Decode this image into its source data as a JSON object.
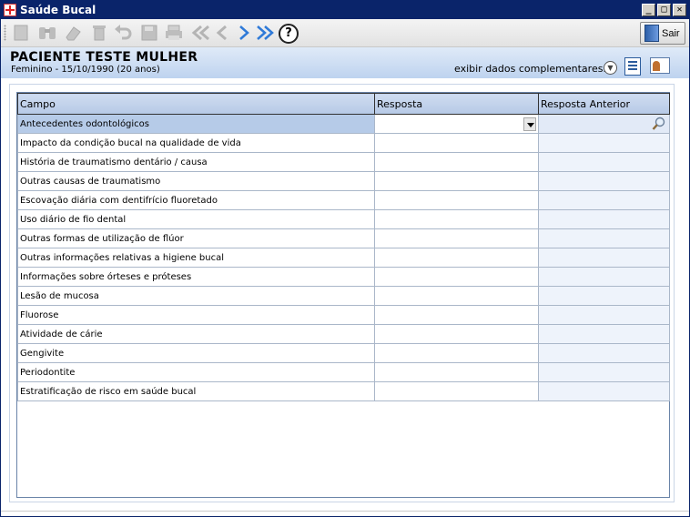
{
  "window": {
    "title": "Saúde Bucal",
    "controls": {
      "minimize": "_",
      "maximize": "□",
      "close": "✕"
    }
  },
  "toolbar": {
    "icons": [
      "new-icon",
      "binoculars-icon",
      "eraser-icon",
      "trash-icon",
      "undo-icon",
      "save-icon",
      "print-icon",
      "first-icon",
      "prev-icon",
      "next-icon",
      "last-icon"
    ],
    "help_label": "?",
    "exit_label": "Sair"
  },
  "patient": {
    "name": "PACIENTE TESTE MULHER",
    "info": "Feminino - 15/10/1990 (20 anos)",
    "extra_link": "exibir dados complementares..."
  },
  "grid": {
    "columns": [
      "Campo",
      "Resposta",
      "Resposta Anterior"
    ],
    "rows": [
      "Antecedentes odontológicos",
      "Impacto da condição bucal na qualidade de vida",
      "História de traumatismo dentário / causa",
      "Outras causas de traumatismo",
      "Escovação diária com dentifrício fluoretado",
      "Uso diário de fio dental",
      "Outras formas de utilização de flúor",
      "Outras informações relativas a higiene bucal",
      "Informações sobre órteses e próteses",
      "Lesão de mucosa",
      "Fluorose",
      "Atividade de cárie",
      "Gengivite",
      "Periodontite",
      "Estratificação de risco em saúde bucal"
    ],
    "selected_row": 0
  },
  "colors": {
    "titlebar": "#0a246a",
    "header_bg": "#bed3ef",
    "selected_row": "#b6cbe8"
  }
}
